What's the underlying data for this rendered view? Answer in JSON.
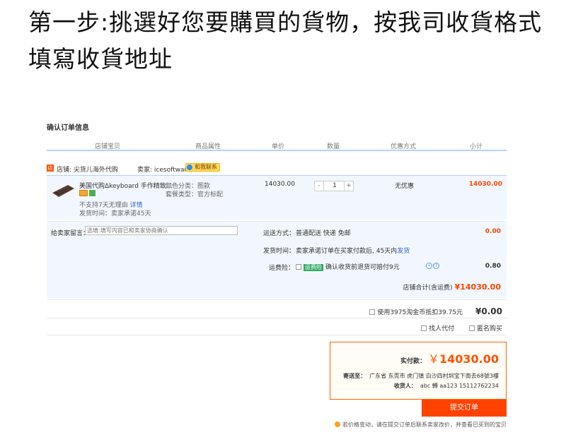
{
  "heading": "第一步:挑選好您要購買的貨物，按我司收貨格式填寫收貨地址",
  "order": {
    "title": "确认订单信息",
    "columns": [
      "店铺宝贝",
      "商品属性",
      "单价",
      "数量",
      "优惠方式",
      "小计"
    ],
    "shop_icon": "店",
    "shop_label": "店铺: 尖货儿海外代购",
    "seller_label": "卖家: icesoftware",
    "contact_label": "和我联系",
    "item": {
      "name": "美国代购Δkeyboard 手作精致...",
      "note": "不支持7天无理由",
      "note_link": "详情",
      "ship": "发货时间：卖家承诺45天",
      "color_attr": "颜色分类：图款",
      "package_attr": "套餐类型：官方标配",
      "price": "14030.00",
      "qty_minus": "-",
      "qty_value": "1",
      "qty_plus": "+",
      "discount": "无优惠",
      "subtotal": "14030.00"
    },
    "message": {
      "label": "给卖家留言：",
      "placeholder": "选填:填写内容已和卖家协商确认"
    },
    "shipping": {
      "label": "运送方式：",
      "value": "普通配送 快递 免邮",
      "cost": "0.00"
    },
    "delivery": {
      "label": "发货时间：",
      "value": "卖家承诺订单在买家付款后, 45天内",
      "link": "发货"
    },
    "insurance": {
      "label": "运费险：",
      "tag": "运费险",
      "text": "确认收货前退货可赔付9元",
      "cost": "0.80"
    },
    "shop_total": {
      "label": "店铺合计(含运费)",
      "amount": "¥14030.00"
    },
    "points": {
      "text": "使用3975淘金币抵扣39.75元",
      "amount": "¥0.00"
    },
    "options": [
      "找人代付",
      "匿名购买"
    ],
    "summary": {
      "pay_label": "实付款：",
      "currency": "￥",
      "pay_amount": "14030.00",
      "address_label": "寄送至：",
      "address": "广东省 东莞市   虎门镇 白沙四村圳宝下南去68號3樓",
      "receiver_label": "收货人：",
      "receiver": "abc 轉 aa123 15112762234"
    },
    "submit_label": "提交订单",
    "tip": "若价格变动，请在提交订单后联系卖家改价，并查看已买到的宝贝"
  }
}
